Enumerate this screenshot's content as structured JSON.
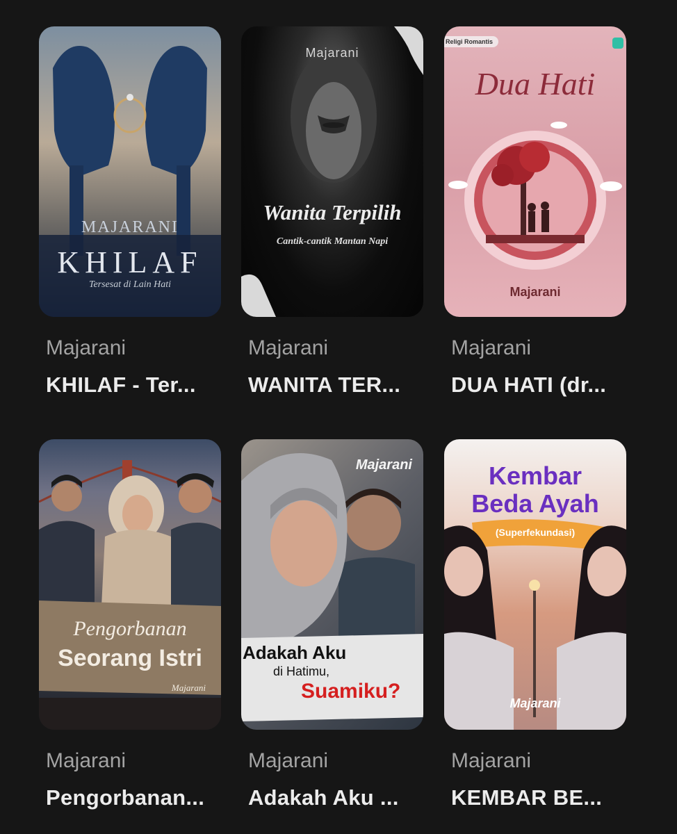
{
  "books": [
    {
      "author": "Majarani",
      "title": "KHILAF - Ter...",
      "cover": {
        "author_text": "MAJARANI",
        "title_text": "KHILAF",
        "subtitle_text": "Tersesat di Lain Hati"
      }
    },
    {
      "author": "Majarani",
      "title": "WANITA TER...",
      "cover": {
        "author_text": "Majarani",
        "title_text": "Wanita Terpilih",
        "subtitle_text": "Cantik-cantik Mantan Napi"
      }
    },
    {
      "author": "Majarani",
      "title": "DUA HATI (dr...",
      "cover": {
        "author_text": "Majarani",
        "title_text": "Dua Hati",
        "badge_text": "Religi Romantis"
      }
    },
    {
      "author": "Majarani",
      "title": "Pengorbanan...",
      "cover": {
        "author_text": "Majarani",
        "title_line1": "Pengorbanan",
        "title_line2": "Seorang Istri"
      }
    },
    {
      "author": "Majarani",
      "title": "Adakah Aku ...",
      "cover": {
        "author_text": "Majarani",
        "title_line1": "Adakah Aku",
        "title_line2": "di Hatimu,",
        "title_line3": "Suamiku?"
      }
    },
    {
      "author": "Majarani",
      "title": "KEMBAR BE...",
      "cover": {
        "author_text": "Majarani",
        "title_line1": "Kembar",
        "title_line2": "Beda Ayah",
        "subtitle_text": "(Superfekundasi)"
      }
    }
  ]
}
